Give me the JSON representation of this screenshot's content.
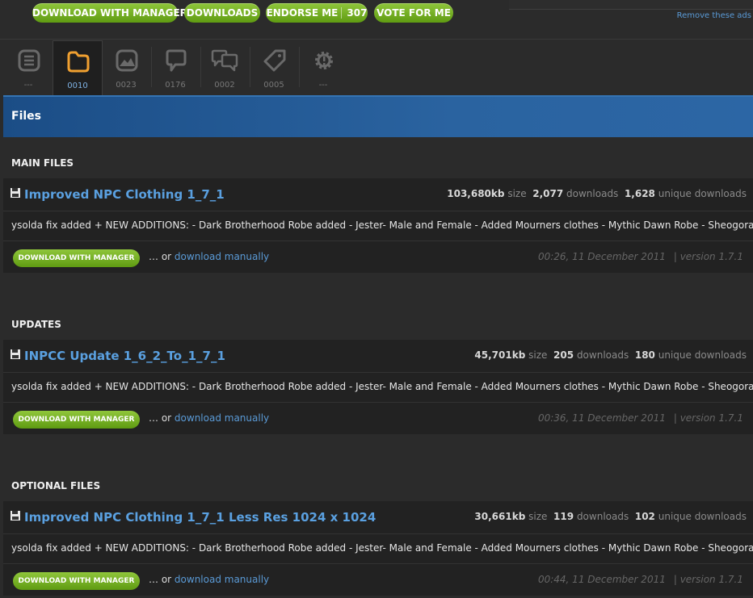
{
  "topbar": {
    "download_manager": "DOWNLOAD WITH MANAGER",
    "downloads": "DOWNLOADS",
    "endorse": "ENDORSE ME",
    "endorse_count": "307",
    "vote": "VOTE FOR ME",
    "remove_ads": "Remove these ads"
  },
  "tabs": [
    {
      "icon": "description-icon",
      "count": "---"
    },
    {
      "icon": "folder-icon",
      "count": "0010"
    },
    {
      "icon": "image-icon",
      "count": "0023"
    },
    {
      "icon": "comment-icon",
      "count": "0176"
    },
    {
      "icon": "discussion-icon",
      "count": "0002"
    },
    {
      "icon": "tag-icon",
      "count": "0005"
    },
    {
      "icon": "gear-icon",
      "count": "---"
    }
  ],
  "colors": {
    "accent_blue": "#5aa0e0",
    "button_green": "#7ab62a",
    "tab_active": "#f0a030"
  },
  "files_header": "Files",
  "sections": [
    {
      "title": "MAIN FILES",
      "file": {
        "name": "Improved NPC Clothing 1_7_1",
        "size": "103,680kb",
        "size_label": "size",
        "downloads": "2,077",
        "downloads_label": "downloads",
        "unique": "1,628",
        "unique_label": "unique downloads",
        "description": "ysolda fix added + NEW ADDITIONS: - Dark Brotherhood Robe added - Jester- Male and Female - Added Mourners clothes - Mythic Dawn Robe - Sheogorath",
        "button": "DOWNLOAD WITH MANAGER",
        "or": "… or",
        "manual": "download manually",
        "date": "00:26, 11 December 2011",
        "version": "| version 1.7.1"
      }
    },
    {
      "title": "UPDATES",
      "file": {
        "name": "INPCC Update 1_6_2_To_1_7_1",
        "size": "45,701kb",
        "size_label": "size",
        "downloads": "205",
        "downloads_label": "downloads",
        "unique": "180",
        "unique_label": "unique downloads",
        "description": "ysolda fix added + NEW ADDITIONS: - Dark Brotherhood Robe added - Jester- Male and Female - Added Mourners clothes - Mythic Dawn Robe - Sheogorath",
        "button": "DOWNLOAD WITH MANAGER",
        "or": "… or",
        "manual": "download manually",
        "date": "00:36, 11 December 2011",
        "version": "| version 1.7.1"
      }
    },
    {
      "title": "OPTIONAL FILES",
      "file": {
        "name": "Improved NPC Clothing 1_7_1 Less Res 1024 x 1024",
        "size": "30,661kb",
        "size_label": "size",
        "downloads": "119",
        "downloads_label": "downloads",
        "unique": "102",
        "unique_label": "unique downloads",
        "description": "ysolda fix added + NEW ADDITIONS: - Dark Brotherhood Robe added - Jester- Male and Female - Added Mourners clothes - Mythic Dawn Robe - Sheogorath",
        "button": "DOWNLOAD WITH MANAGER",
        "or": "… or",
        "manual": "download manually",
        "date": "00:44, 11 December 2011",
        "version": "| version 1.7.1"
      }
    }
  ]
}
